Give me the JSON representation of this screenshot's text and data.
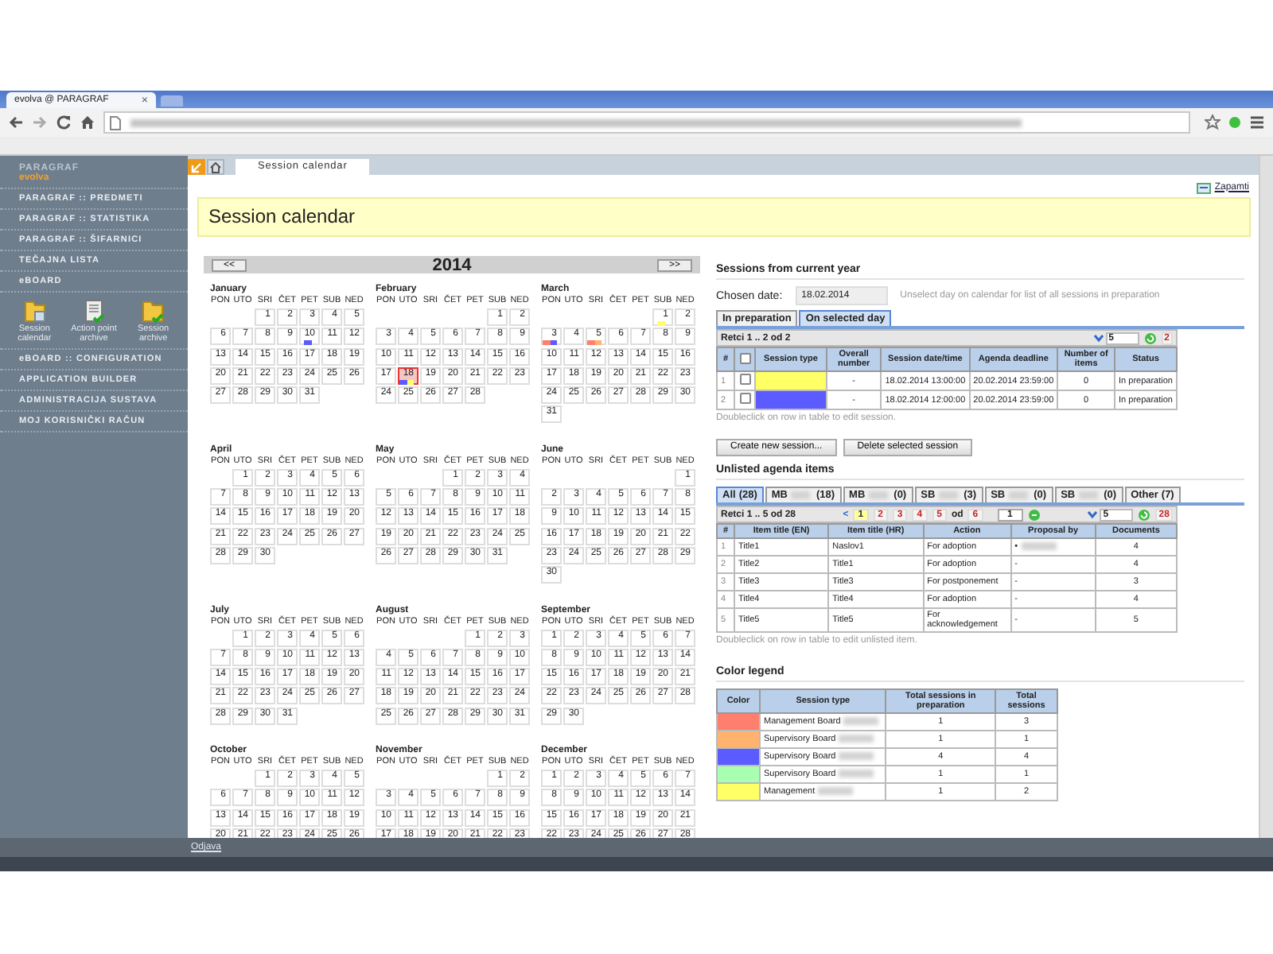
{
  "browser": {
    "tab_title": "evolva @ PARAGRAF",
    "tab_close": "×"
  },
  "sidebar": {
    "brand": "PARAGRAF",
    "product": "evolva",
    "items": [
      {
        "kind": "link",
        "label": "PARAGRAF :: PREDMETI"
      },
      {
        "kind": "link",
        "label": "PARAGRAF :: STATISTIKA"
      },
      {
        "kind": "link",
        "label": "PARAGRAF :: ŠIFARNICI"
      },
      {
        "kind": "link",
        "label": "TEČAJNA LISTA"
      },
      {
        "kind": "link",
        "label": "eBOARD"
      },
      {
        "kind": "launcher",
        "apps": [
          {
            "label": "Session calendar"
          },
          {
            "label": "Action point archive"
          },
          {
            "label": "Session archive"
          }
        ]
      },
      {
        "kind": "link",
        "label": "eBOARD :: CONFIGURATION"
      },
      {
        "kind": "link",
        "label": "APPLICATION BUILDER"
      },
      {
        "kind": "link",
        "label": "ADMINISTRACIJA SUSTAVA"
      },
      {
        "kind": "link",
        "label": "MOJ KORISNIČKI RAČUN"
      }
    ]
  },
  "app_tabs": [
    {
      "label": "Session calendar",
      "selected": true
    }
  ],
  "save_link": "Zapamti",
  "page_title": "Session calendar",
  "calendar": {
    "prev": "<<",
    "year": "2014",
    "next": ">>",
    "months": [
      {
        "name": "January",
        "weekdays": [
          "PON",
          "UTO",
          "SRI",
          "ČET",
          "PET",
          "SUB",
          "NED"
        ],
        "weeks": [
          [
            "1",
            "2",
            "3",
            "4",
            "5"
          ],
          [
            "6",
            "7",
            "8",
            "9",
            {
              "day": "10",
              "marks": [
                {
                  "color": "#5b5bff"
                }
              ]
            },
            "11",
            "12"
          ],
          [
            "13",
            "14",
            "15",
            "16",
            "17",
            "18",
            "19"
          ],
          [
            "20",
            "21",
            "22",
            "23",
            "24",
            "25",
            "26"
          ],
          [
            "27",
            "28",
            "29",
            "30",
            "31"
          ]
        ]
      },
      {
        "name": "February",
        "weekdays": [
          "PON",
          "UTO",
          "SRI",
          "ČET",
          "PET",
          "SUB",
          "NED"
        ],
        "weeks": [
          [
            "1",
            "2"
          ],
          [
            "3",
            "4",
            "5",
            "6",
            "7",
            "8",
            "9"
          ],
          [
            "10",
            "11",
            "12",
            "13",
            "14",
            "15",
            "16"
          ],
          [
            "17",
            {
              "day": "18",
              "selected": true,
              "marks": [
                {
                  "color": "#5b5bff"
                },
                {
                  "color": "#ffff66"
                }
              ]
            },
            "19",
            "20",
            "21",
            "22",
            "23"
          ],
          [
            "24",
            "25",
            "26",
            "27",
            "28"
          ]
        ]
      },
      {
        "name": "March",
        "weekdays": [
          "PON",
          "UTO",
          "SRI",
          "ČET",
          "PET",
          "SUB",
          "NED"
        ],
        "weeks": [
          [
            {
              "day": "1",
              "marks": [
                {
                  "color": "#ffff66"
                }
              ]
            },
            "2"
          ],
          [
            {
              "day": "3",
              "marks": [
                {
                  "color": "#ff7f6e"
                },
                {
                  "color": "#5b5bff"
                }
              ]
            },
            "4",
            {
              "day": "5",
              "marks": [
                {
                  "color": "#ff7f6e"
                },
                {
                  "color": "#ffb36e"
                }
              ]
            },
            "6",
            "7",
            "8",
            "9"
          ],
          [
            "10",
            "11",
            "12",
            "13",
            "14",
            "15",
            "16"
          ],
          [
            "17",
            "18",
            "19",
            "20",
            "21",
            "22",
            "23"
          ],
          [
            "24",
            "25",
            "26",
            "27",
            "28",
            "29",
            "30"
          ],
          [
            "31"
          ]
        ]
      },
      {
        "name": "April",
        "weekdays": [
          "PON",
          "UTO",
          "SRI",
          "ČET",
          "PET",
          "SUB",
          "NED"
        ],
        "weeks": [
          [
            "1",
            "2",
            "3",
            "4",
            "5",
            "6"
          ],
          [
            "7",
            "8",
            "9",
            "10",
            "11",
            "12",
            "13"
          ],
          [
            "14",
            "15",
            "16",
            "17",
            "18",
            "19",
            "20"
          ],
          [
            "21",
            "22",
            "23",
            "24",
            "25",
            "26",
            "27"
          ],
          [
            "28",
            "29",
            "30"
          ]
        ]
      },
      {
        "name": "May",
        "weekdays": [
          "PON",
          "UTO",
          "SRI",
          "ČET",
          "PET",
          "SUB",
          "NED"
        ],
        "weeks": [
          [
            "1",
            "2",
            "3",
            "4"
          ],
          [
            "5",
            "6",
            "7",
            "8",
            "9",
            "10",
            "11"
          ],
          [
            "12",
            "13",
            "14",
            "15",
            "16",
            "17",
            "18"
          ],
          [
            "19",
            "20",
            "21",
            "22",
            "23",
            "24",
            "25"
          ],
          [
            "26",
            "27",
            "28",
            "29",
            "30",
            "31"
          ]
        ]
      },
      {
        "name": "June",
        "weekdays": [
          "PON",
          "UTO",
          "SRI",
          "ČET",
          "PET",
          "SUB",
          "NED"
        ],
        "weeks": [
          [
            "1"
          ],
          [
            "2",
            "3",
            "4",
            "5",
            "6",
            "7",
            "8"
          ],
          [
            "9",
            "10",
            "11",
            "12",
            "13",
            "14",
            "15"
          ],
          [
            "16",
            "17",
            "18",
            "19",
            "20",
            "21",
            "22"
          ],
          [
            "23",
            "24",
            "25",
            "26",
            "27",
            "28",
            "29"
          ],
          [
            "30"
          ]
        ]
      },
      {
        "name": "July",
        "weekdays": [
          "PON",
          "UTO",
          "SRI",
          "ČET",
          "PET",
          "SUB",
          "NED"
        ],
        "weeks": [
          [
            "1",
            "2",
            "3",
            "4",
            "5",
            "6"
          ],
          [
            "7",
            "8",
            "9",
            "10",
            "11",
            "12",
            "13"
          ],
          [
            "14",
            "15",
            "16",
            "17",
            "18",
            "19",
            "20"
          ],
          [
            "21",
            "22",
            "23",
            "24",
            "25",
            "26",
            "27"
          ],
          [
            "28",
            "29",
            "30",
            "31"
          ]
        ]
      },
      {
        "name": "August",
        "weekdays": [
          "PON",
          "UTO",
          "SRI",
          "ČET",
          "PET",
          "SUB",
          "NED"
        ],
        "weeks": [
          [
            "1",
            "2",
            "3"
          ],
          [
            "4",
            "5",
            "6",
            "7",
            "8",
            "9",
            "10"
          ],
          [
            "11",
            "12",
            "13",
            "14",
            "15",
            "16",
            "17"
          ],
          [
            "18",
            "19",
            "20",
            "21",
            "22",
            "23",
            "24"
          ],
          [
            "25",
            "26",
            "27",
            "28",
            "29",
            "30",
            "31"
          ]
        ]
      },
      {
        "name": "September",
        "weekdays": [
          "PON",
          "UTO",
          "SRI",
          "ČET",
          "PET",
          "SUB",
          "NED"
        ],
        "weeks": [
          [
            "1",
            "2",
            "3",
            "4",
            "5",
            "6",
            "7"
          ],
          [
            "8",
            "9",
            "10",
            "11",
            "12",
            "13",
            "14"
          ],
          [
            "15",
            "16",
            "17",
            "18",
            "19",
            "20",
            "21"
          ],
          [
            "22",
            "23",
            "24",
            "25",
            "26",
            "27",
            "28"
          ],
          [
            "29",
            "30"
          ]
        ]
      },
      {
        "name": "October",
        "weekdays": [
          "PON",
          "UTO",
          "SRI",
          "ČET",
          "PET",
          "SUB",
          "NED"
        ],
        "weeks": [
          [
            "1",
            "2",
            "3",
            "4",
            "5"
          ],
          [
            "6",
            "7",
            "8",
            "9",
            "10",
            "11",
            "12"
          ],
          [
            "13",
            "14",
            "15",
            "16",
            "17",
            "18",
            "19"
          ],
          [
            "20",
            "21",
            "22",
            "23",
            "24",
            "25",
            "26"
          ]
        ]
      },
      {
        "name": "November",
        "weekdays": [
          "PON",
          "UTO",
          "SRI",
          "ČET",
          "PET",
          "SUB",
          "NED"
        ],
        "weeks": [
          [
            "1",
            "2"
          ],
          [
            "3",
            "4",
            "5",
            "6",
            "7",
            "8",
            "9"
          ],
          [
            "10",
            "11",
            "12",
            "13",
            "14",
            "15",
            "16"
          ],
          [
            "17",
            "18",
            "19",
            "20",
            "21",
            "22",
            "23"
          ]
        ]
      },
      {
        "name": "December",
        "weekdays": [
          "PON",
          "UTO",
          "SRI",
          "ČET",
          "PET",
          "SUB",
          "NED"
        ],
        "weeks": [
          [
            "1",
            "2",
            "3",
            "4",
            "5",
            "6",
            "7"
          ],
          [
            "8",
            "9",
            "10",
            "11",
            "12",
            "13",
            "14"
          ],
          [
            "15",
            "16",
            "17",
            "18",
            "19",
            "20",
            "21"
          ],
          [
            "22",
            "23",
            "24",
            "25",
            "26",
            "27",
            "28"
          ]
        ]
      }
    ]
  },
  "sessions": {
    "title": "Sessions from current year",
    "date_label": "Chosen date:",
    "date_value": "18.02.2014",
    "hint": "Unselect day on calendar for list of all sessions in preparation",
    "tabs": [
      {
        "label": "In preparation",
        "selected": false
      },
      {
        "label": "On selected day",
        "selected": true
      }
    ],
    "range": "Retci 1 .. 2 od 2",
    "page_size": "5",
    "total": "2",
    "all_checked": false,
    "columns": [
      "#",
      "Session type",
      "Overall number",
      "Session date/time",
      "Agenda deadline",
      "Number of items",
      "Status"
    ],
    "rows": [
      {
        "num": "1",
        "checked": false,
        "color": "#ffff66",
        "overall": "-",
        "datetime": "18.02.2014 13:00:00",
        "deadline": "20.02.2014 23:59:00",
        "items": "0",
        "status": "In preparation"
      },
      {
        "num": "2",
        "checked": false,
        "color": "#5b5bff",
        "overall": "-",
        "datetime": "18.02.2014 12:00:00",
        "deadline": "20.02.2014 23:59:00",
        "items": "0",
        "status": "In preparation"
      }
    ],
    "note": "Doubleclick on row in table to edit session.",
    "buttons": [
      "Create new session...",
      "Delete selected session"
    ]
  },
  "agenda": {
    "title": "Unlisted agenda items",
    "tabs": [
      {
        "label": "All",
        "count": "(28)",
        "redacted": false,
        "selected": true
      },
      {
        "label": "MB",
        "count": "(18)",
        "redacted": true,
        "selected": false
      },
      {
        "label": "MB",
        "count": "(0)",
        "redacted": true,
        "selected": false
      },
      {
        "label": "SB",
        "count": "(3)",
        "redacted": true,
        "selected": false
      },
      {
        "label": "SB",
        "count": "(0)",
        "redacted": true,
        "selected": false
      },
      {
        "label": "SB",
        "count": "(0)",
        "redacted": true,
        "selected": false
      },
      {
        "label": "Other",
        "count": "(7)",
        "redacted": false,
        "selected": false
      }
    ],
    "range": "Retci 1 .. 5 od 28",
    "prev": "<",
    "pages": [
      {
        "label": "1",
        "selected": true
      },
      {
        "label": "2",
        "selected": false
      },
      {
        "label": "3",
        "selected": false
      },
      {
        "label": "4",
        "selected": false
      },
      {
        "label": "5",
        "selected": false
      }
    ],
    "of": "od",
    "last_page": "6",
    "page_input": "1",
    "page_size": "5",
    "total": "28",
    "columns": [
      "#",
      "Item title (EN)",
      "Item title (HR)",
      "Action",
      "Proposal by",
      "Documents"
    ],
    "rows": [
      {
        "num": "1",
        "en": "Title1",
        "hr": "Naslov1",
        "action": "For adoption",
        "proposal": "•",
        "redacted": true,
        "docs": "4"
      },
      {
        "num": "2",
        "en": "Title2",
        "hr": "Title1",
        "action": "For adoption",
        "proposal": "-",
        "redacted": false,
        "docs": "4"
      },
      {
        "num": "3",
        "en": "Title3",
        "hr": "Title3",
        "action": "For postponement",
        "proposal": "-",
        "redacted": false,
        "docs": "3"
      },
      {
        "num": "4",
        "en": "Title4",
        "hr": "Title4",
        "action": "For adoption",
        "proposal": "-",
        "redacted": false,
        "docs": "4"
      },
      {
        "num": "5",
        "en": "Title5",
        "hr": "Title5",
        "action": "For acknowledgement",
        "proposal": "-",
        "redacted": false,
        "docs": "5"
      }
    ],
    "note": "Doubleclick on row in table to edit unlisted item."
  },
  "legend": {
    "title": "Color legend",
    "columns": [
      "Color",
      "Session type",
      "Total sessions in preparation",
      "Total sessions"
    ],
    "rows": [
      {
        "color": "#ff7f6e",
        "type": "Management Board",
        "redacted": true,
        "in_prep": "1",
        "total": "3"
      },
      {
        "color": "#ffb36e",
        "type": "Supervisory Board",
        "redacted": true,
        "in_prep": "1",
        "total": "1"
      },
      {
        "color": "#5b5bff",
        "type": "Supervisory Board",
        "redacted": true,
        "in_prep": "4",
        "total": "4"
      },
      {
        "color": "#a8ffb0",
        "type": "Supervisory Board",
        "redacted": true,
        "in_prep": "1",
        "total": "1"
      },
      {
        "color": "#ffff66",
        "type": "Management",
        "redacted": true,
        "in_prep": "1",
        "total": "2"
      }
    ]
  },
  "footer": {
    "logout": "Odjava"
  }
}
